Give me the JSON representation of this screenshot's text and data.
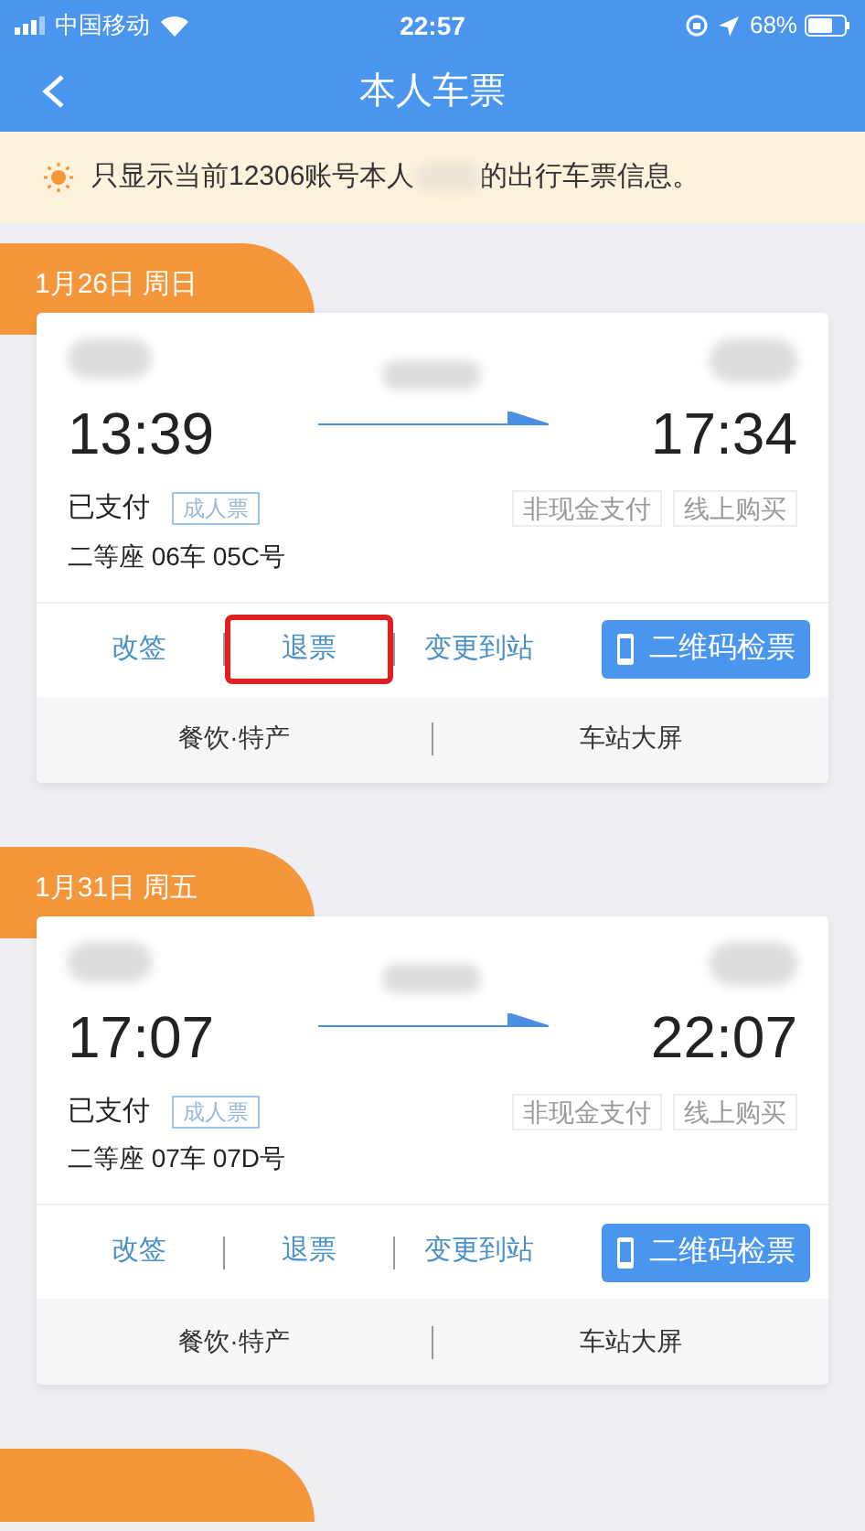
{
  "status_bar": {
    "carrier": "中国移动",
    "time": "22:57",
    "battery": "68%"
  },
  "nav": {
    "title": "本人车票"
  },
  "notice": {
    "before": "只显示当前12306账号本人",
    "after": "的出行车票信息。"
  },
  "tickets": [
    {
      "date": "1月26日 周日",
      "depart_time": "13:39",
      "arrive_time": "17:34",
      "status": "已支付",
      "ticket_type": "成人票",
      "tags": [
        "非现金支付",
        "线上购买"
      ],
      "seat": "二等座 06车 05C号",
      "actions": [
        {
          "label": "改签",
          "highlighted": false
        },
        {
          "label": "退票",
          "highlighted": true
        },
        {
          "label": "变更到站",
          "highlighted": false
        }
      ],
      "qr_button": "二维码检票",
      "links": [
        "餐饮·特产",
        "车站大屏"
      ]
    },
    {
      "date": "1月31日 周五",
      "depart_time": "17:07",
      "arrive_time": "22:07",
      "status": "已支付",
      "ticket_type": "成人票",
      "tags": [
        "非现金支付",
        "线上购买"
      ],
      "seat": "二等座 07车 07D号",
      "actions": [
        {
          "label": "改签",
          "highlighted": false
        },
        {
          "label": "退票",
          "highlighted": false
        },
        {
          "label": "变更到站",
          "highlighted": false
        }
      ],
      "qr_button": "二维码检票",
      "links": [
        "餐饮·特产",
        "车站大屏"
      ]
    }
  ]
}
